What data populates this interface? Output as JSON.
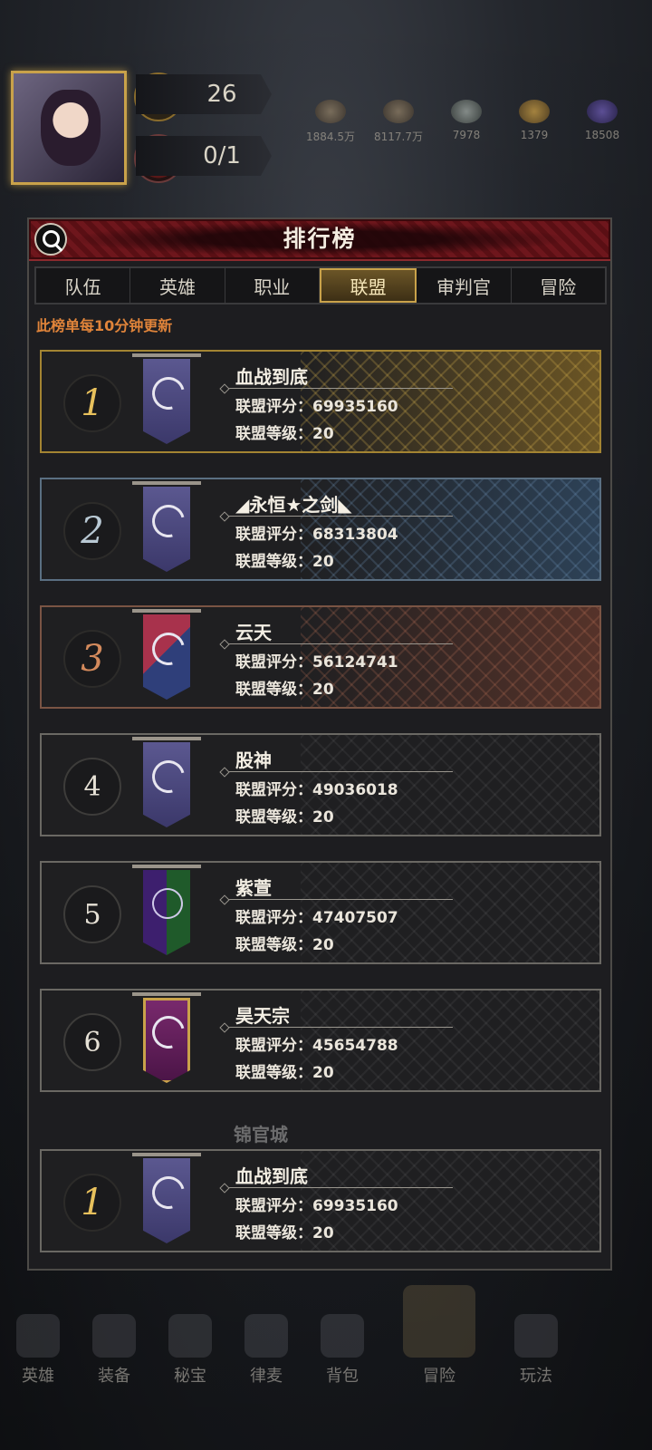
{
  "hud": {
    "level": "26",
    "stamina": "0/1",
    "resources": [
      "1884.5万",
      "8117.7万",
      "7978",
      "1379",
      "18508"
    ]
  },
  "panel": {
    "title": "排行榜",
    "tabs": [
      "队伍",
      "英雄",
      "职业",
      "联盟",
      "审判官",
      "冒险"
    ],
    "active_tab": "联盟",
    "notice": "此榜单每10分钟更新"
  },
  "labels": {
    "score": "联盟评分：",
    "level": "联盟等级："
  },
  "rankings": [
    {
      "rank": "1",
      "name": "血战到底",
      "score": "69935160",
      "level": "20"
    },
    {
      "rank": "2",
      "name": "◢永恒★之剑◣",
      "score": "68313804",
      "level": "20"
    },
    {
      "rank": "3",
      "name": "云天",
      "score": "56124741",
      "level": "20"
    },
    {
      "rank": "4",
      "name": "股神",
      "score": "49036018",
      "level": "20"
    },
    {
      "rank": "5",
      "name": "紫萱",
      "score": "47407507",
      "level": "20"
    },
    {
      "rank": "6",
      "name": "昊天宗",
      "score": "45654788",
      "level": "20"
    }
  ],
  "partial_next": {
    "name": "锦官城"
  },
  "my_alliance": {
    "rank": "1",
    "name": "血战到底",
    "score": "69935160",
    "level": "20"
  },
  "bottom_nav": [
    "英雄",
    "装备",
    "秘宝",
    "律麦",
    "背包",
    "冒险",
    "玩法"
  ],
  "colors": {
    "accent_gold": "#c9a24a",
    "notice_orange": "#e0843a",
    "header_red": "#6e161c"
  }
}
